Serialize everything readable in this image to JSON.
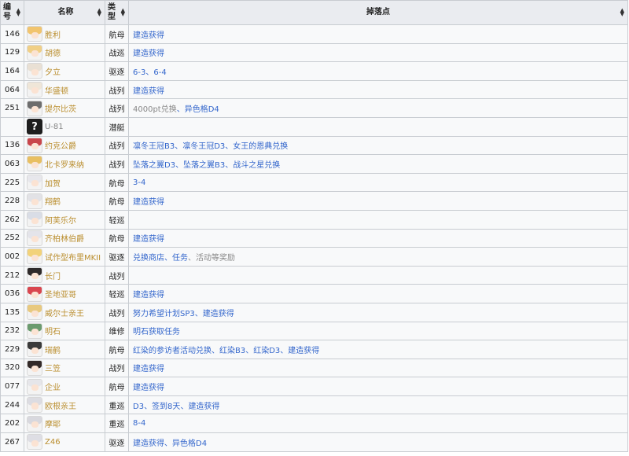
{
  "headers": {
    "id": "编号",
    "name": "名称",
    "type": "类型",
    "drop": "掉落点"
  },
  "rows": [
    {
      "id": "146",
      "name": "胜利",
      "type": "航母",
      "hair": "#f1c46e",
      "drops": [
        {
          "t": "建造获得",
          "l": true
        }
      ]
    },
    {
      "id": "129",
      "name": "胡德",
      "type": "战巡",
      "hair": "#f0cf86",
      "drops": [
        {
          "t": "建造获得",
          "l": true
        }
      ]
    },
    {
      "id": "164",
      "name": "夕立",
      "type": "驱逐",
      "hair": "#e9e0d4",
      "drops": [
        {
          "t": "6-3",
          "l": true
        },
        {
          "t": "6-4",
          "l": true
        }
      ]
    },
    {
      "id": "064",
      "name": "华盛顿",
      "type": "战列",
      "hair": "#efe6d8",
      "drops": [
        {
          "t": "建造获得",
          "l": true
        }
      ]
    },
    {
      "id": "251",
      "name": "提尔比茨",
      "type": "战列",
      "hair": "#6d6d6d",
      "drops": [
        {
          "t": "4000pt兑换",
          "l": false
        },
        {
          "t": "异色格D4",
          "l": true
        }
      ]
    },
    {
      "id": "",
      "name": "U-81",
      "type": "潜艇",
      "unknown": true,
      "drops": []
    },
    {
      "id": "136",
      "name": "约克公爵",
      "type": "战列",
      "hair": "#c9464b",
      "drops": [
        {
          "t": "凛冬王冠B3",
          "l": true
        },
        {
          "t": "凛冬王冠D3",
          "l": true
        },
        {
          "t": "女王的恩典兑换",
          "l": true
        }
      ]
    },
    {
      "id": "063",
      "name": "北卡罗来纳",
      "type": "战列",
      "hair": "#e8bf62",
      "drops": [
        {
          "t": "坠落之翼D3",
          "l": true
        },
        {
          "t": "坠落之翼B3",
          "l": true
        },
        {
          "t": "战斗之星兑换",
          "l": true
        }
      ]
    },
    {
      "id": "225",
      "name": "加贺",
      "type": "航母",
      "hair": "#e7e7ec",
      "drops": [
        {
          "t": "3-4",
          "l": true
        }
      ]
    },
    {
      "id": "228",
      "name": "翔鹤",
      "type": "航母",
      "hair": "#e2e2e6",
      "drops": [
        {
          "t": "建造获得",
          "l": true
        }
      ]
    },
    {
      "id": "262",
      "name": "阿芙乐尔",
      "type": "轻巡",
      "hair": "#d9dde6",
      "drops": []
    },
    {
      "id": "252",
      "name": "齐柏林伯爵",
      "type": "航母",
      "hair": "#e4e4ea",
      "drops": [
        {
          "t": "建造获得",
          "l": true
        }
      ]
    },
    {
      "id": "002",
      "name": "试作型布里MKII",
      "type": "驱逐",
      "hair": "#f2d27a",
      "drops": [
        {
          "t": "兑换商店",
          "l": true
        },
        {
          "t": "任务",
          "l": true
        },
        {
          "t": "活动等奖励",
          "l": false
        }
      ]
    },
    {
      "id": "212",
      "name": "长门",
      "type": "战列",
      "hair": "#2e2a2a",
      "drops": []
    },
    {
      "id": "036",
      "name": "圣地亚哥",
      "type": "轻巡",
      "hair": "#d9464f",
      "drops": [
        {
          "t": "建造获得",
          "l": true
        }
      ]
    },
    {
      "id": "135",
      "name": "威尔士亲王",
      "type": "战列",
      "hair": "#e8c97f",
      "drops": [
        {
          "t": "努力希望计划SP3",
          "l": true
        },
        {
          "t": "建造获得",
          "l": true
        }
      ]
    },
    {
      "id": "232",
      "name": "明石",
      "type": "维修",
      "hair": "#6b9b6f",
      "drops": [
        {
          "t": "明石获取任务",
          "l": true
        }
      ]
    },
    {
      "id": "229",
      "name": "瑞鹤",
      "type": "航母",
      "hair": "#3a3a3a",
      "drops": [
        {
          "t": "红染的参访者活动兑换",
          "l": true
        },
        {
          "t": "红染B3",
          "l": true
        },
        {
          "t": "红染D3",
          "l": true
        },
        {
          "t": "建造获得",
          "l": true
        }
      ]
    },
    {
      "id": "320",
      "name": "三笠",
      "type": "战列",
      "hair": "#332a28",
      "drops": [
        {
          "t": "建造获得",
          "l": true
        }
      ]
    },
    {
      "id": "077",
      "name": "企业",
      "type": "航母",
      "hair": "#e6e6ea",
      "drops": [
        {
          "t": "建造获得",
          "l": true
        }
      ]
    },
    {
      "id": "244",
      "name": "欧根亲王",
      "type": "重巡",
      "hair": "#dcdce2",
      "drops": [
        {
          "t": "D3",
          "l": true
        },
        {
          "t": "签到8天",
          "l": true
        },
        {
          "t": "建造获得",
          "l": true
        }
      ]
    },
    {
      "id": "202",
      "name": "摩耶",
      "type": "重巡",
      "hair": "#d8d8de",
      "drops": [
        {
          "t": "8-4",
          "l": true
        }
      ]
    },
    {
      "id": "267",
      "name": "Z46",
      "type": "驱逐",
      "hair": "#dedee4",
      "drops": [
        {
          "t": "建造获得",
          "l": true
        },
        {
          "t": "异色格D4",
          "l": true
        }
      ]
    }
  ]
}
